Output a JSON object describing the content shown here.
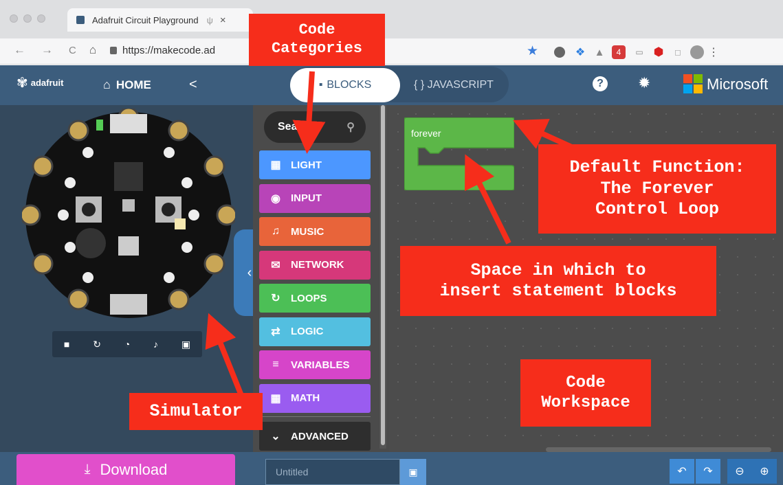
{
  "browser": {
    "tab_title": "Adafruit Circuit Playground",
    "tab_close": "×",
    "url": "https://makecode.ad",
    "nav_back": "←",
    "nav_forward": "→",
    "nav_reload": "C",
    "nav_home": "⌂",
    "extension_badge": "4"
  },
  "header": {
    "brand": "adafruit",
    "home_label": "HOME",
    "blocks_label": "BLOCKS",
    "javascript_label": "{ } JAVASCRIPT",
    "microsoft_label": "Microsoft"
  },
  "toolbox": {
    "search_placeholder": "Sea...",
    "categories": [
      {
        "label": "LIGHT",
        "color": "#4c97ff"
      },
      {
        "label": "INPUT",
        "color": "#b844b8"
      },
      {
        "label": "MUSIC",
        "color": "#e8643a"
      },
      {
        "label": "NETWORK",
        "color": "#d6387a"
      },
      {
        "label": "LOOPS",
        "color": "#4cbf56"
      },
      {
        "label": "LOGIC",
        "color": "#53bfe0"
      },
      {
        "label": "VARIABLES",
        "color": "#d645c9"
      },
      {
        "label": "MATH",
        "color": "#9a5cf0"
      }
    ],
    "advanced_label": "ADVANCED"
  },
  "workspace": {
    "forever_label": "forever",
    "block_color": "#5cb748"
  },
  "bottom": {
    "download_label": "Download",
    "project_placeholder": "Untitled"
  },
  "annotations": {
    "code_categories": "Code\nCategories",
    "default_function": "Default Function:\nThe Forever\nControl Loop",
    "space_insert": "Space in which to\ninsert statement blocks",
    "code_workspace": "Code\nWorkspace",
    "simulator": "Simulator"
  },
  "colors": {
    "header_bg": "#3c5d7d",
    "annotation_red": "#f62d1b",
    "download_pink": "#e14fcb"
  }
}
